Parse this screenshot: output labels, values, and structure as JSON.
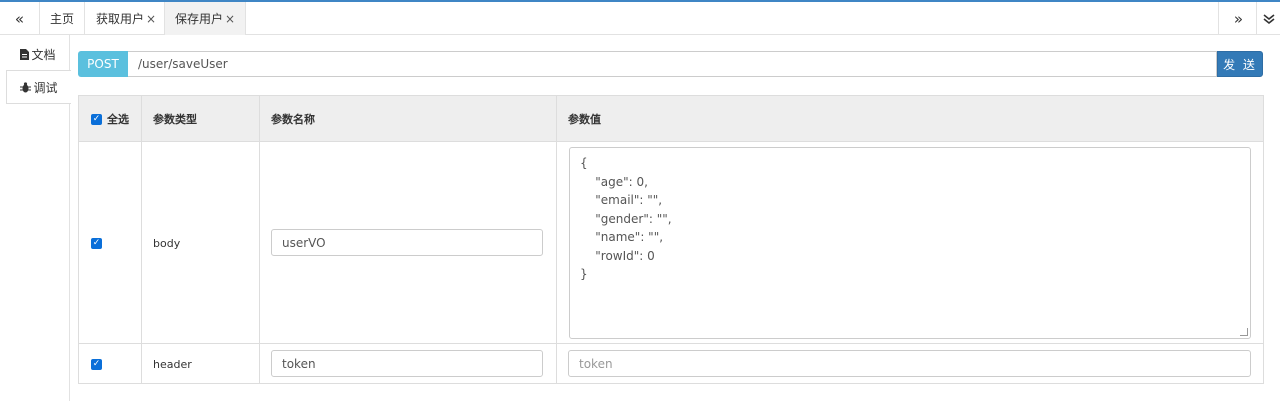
{
  "topbar": {
    "left_arrow": "«",
    "right_arrow": "»",
    "dropdown_arrow": "⌄",
    "tabs": [
      {
        "label": "主页",
        "closable": false,
        "active": false
      },
      {
        "label": "获取用户",
        "closable": true,
        "active": false
      },
      {
        "label": "保存用户",
        "closable": true,
        "active": true
      }
    ],
    "close_glyph": "×",
    "accent_color": "#3f86c5"
  },
  "side": {
    "items": [
      {
        "label": "文档",
        "icon": "file-icon"
      },
      {
        "label": "调试",
        "icon": "bug-icon",
        "active": true
      }
    ]
  },
  "request": {
    "method": "POST",
    "url": "/user/saveUser",
    "send_label": "发 送",
    "method_color": "#5bc0de",
    "send_color": "#337ab7"
  },
  "params": {
    "headers": {
      "select_all": "全选",
      "type": "参数类型",
      "name": "参数名称",
      "value": "参数值"
    },
    "rows": [
      {
        "checked": true,
        "type": "body",
        "name": "userVO",
        "value": "{\n    \"age\": 0,\n    \"email\": \"\",\n    \"gender\": \"\",\n    \"name\": \"\",\n    \"rowId\": 0\n}"
      },
      {
        "checked": true,
        "type": "header",
        "name": "token",
        "value_placeholder": "token"
      }
    ]
  }
}
